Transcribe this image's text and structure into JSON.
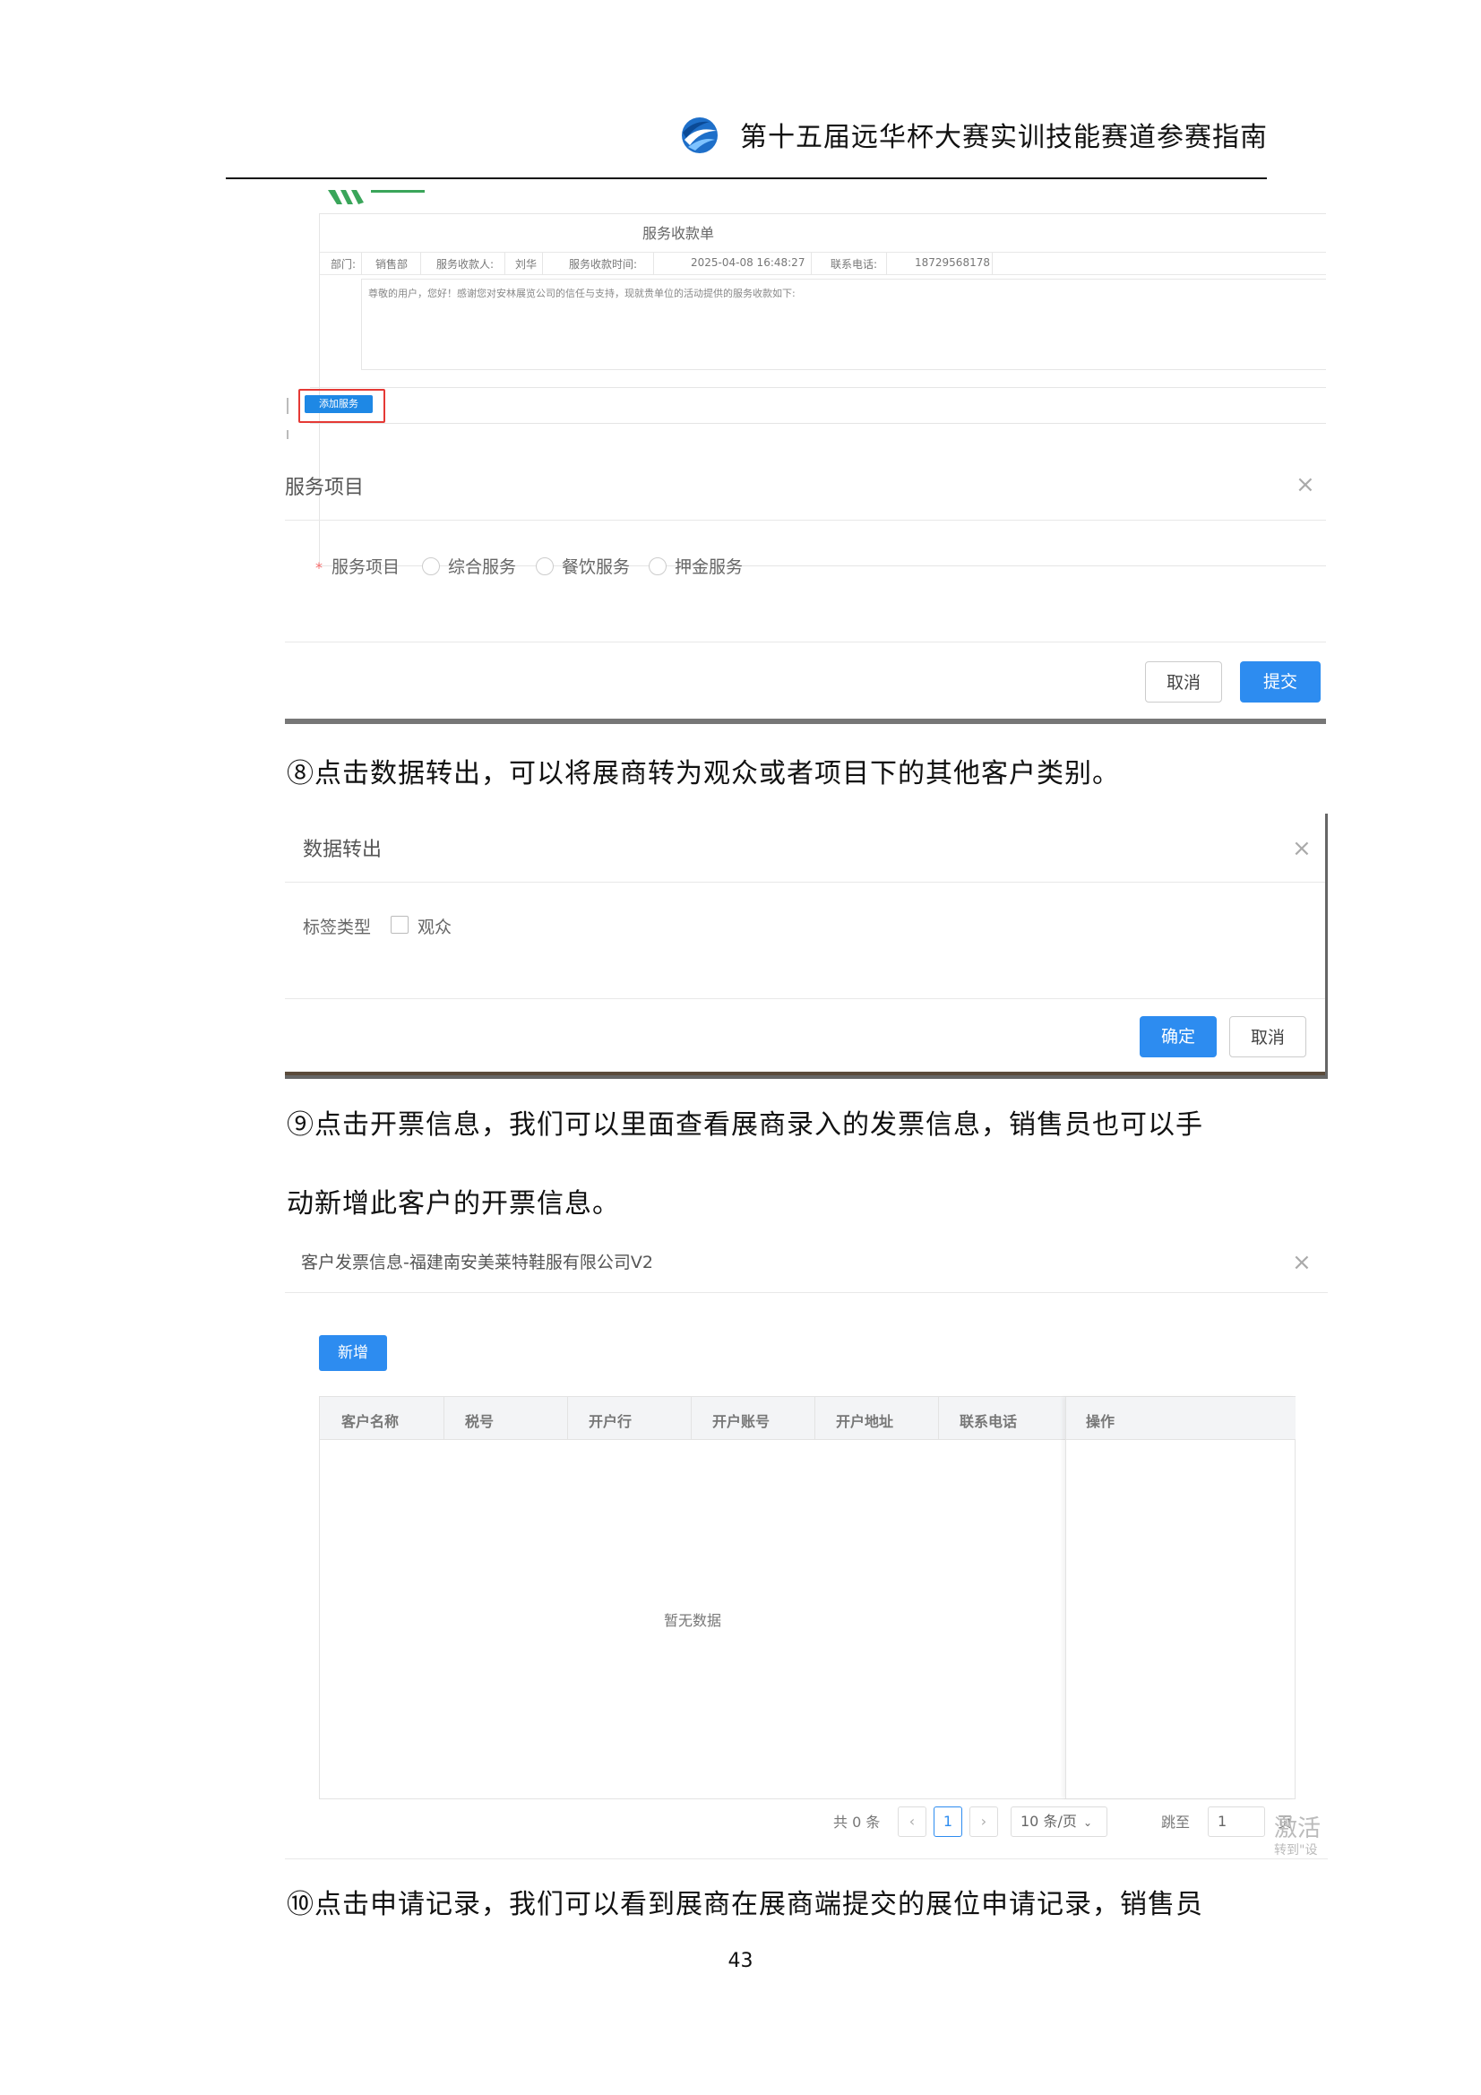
{
  "header": {
    "title": "第十五届远华杯大赛实训技能赛道参赛指南"
  },
  "shot1": {
    "receipt_title": "服务收款单",
    "row": {
      "dept_label": "部门:",
      "dept_value": "销售部",
      "payee_label": "服务收款人:",
      "payee_value": "刘华",
      "time_label": "服务收款时间:",
      "time_value": "2025-04-08 16:48:27",
      "phone_label": "联系电话:",
      "phone_value": "18729568178"
    },
    "note": "尊敬的用户，您好！感谢您对安林展览公司的信任与支持，现就贵单位的活动提供的服务收款如下:",
    "add_button": "添加服务",
    "dialog_title": "服务项目",
    "field_label": "服务项目",
    "options": [
      "综合服务",
      "餐饮服务",
      "押金服务"
    ],
    "cancel": "取消",
    "submit": "提交"
  },
  "para8": "⑧点击数据转出，可以将展商转为观众或者项目下的其他客户类别。",
  "shot2": {
    "title": "数据转出",
    "field_label": "标签类型",
    "checkbox_label": "观众",
    "confirm": "确定",
    "cancel": "取消"
  },
  "para9_line1": "⑨点击开票信息，我们可以里面查看展商录入的发票信息，销售员也可以手",
  "para9_line2": "动新增此客户的开票信息。",
  "shot3": {
    "title": "客户发票信息-福建南安美莱特鞋服有限公司V2",
    "add": "新增",
    "columns": [
      "客户名称",
      "税号",
      "开户行",
      "开户账号",
      "开户地址",
      "联系电话"
    ],
    "op_column": "操作",
    "empty": "暂无数据",
    "total": "共 0 条",
    "prev": "‹",
    "current_page": "1",
    "next": "›",
    "page_size": "10 条/页",
    "jump_to": "跳至",
    "jump_value": "1",
    "page_suffix": "页",
    "watermark1": "激活",
    "watermark2": "转到\"设"
  },
  "para10": "⑩点击申请记录，我们可以看到展商在展商端提交的展位申请记录，销售员",
  "page_number": "43"
}
